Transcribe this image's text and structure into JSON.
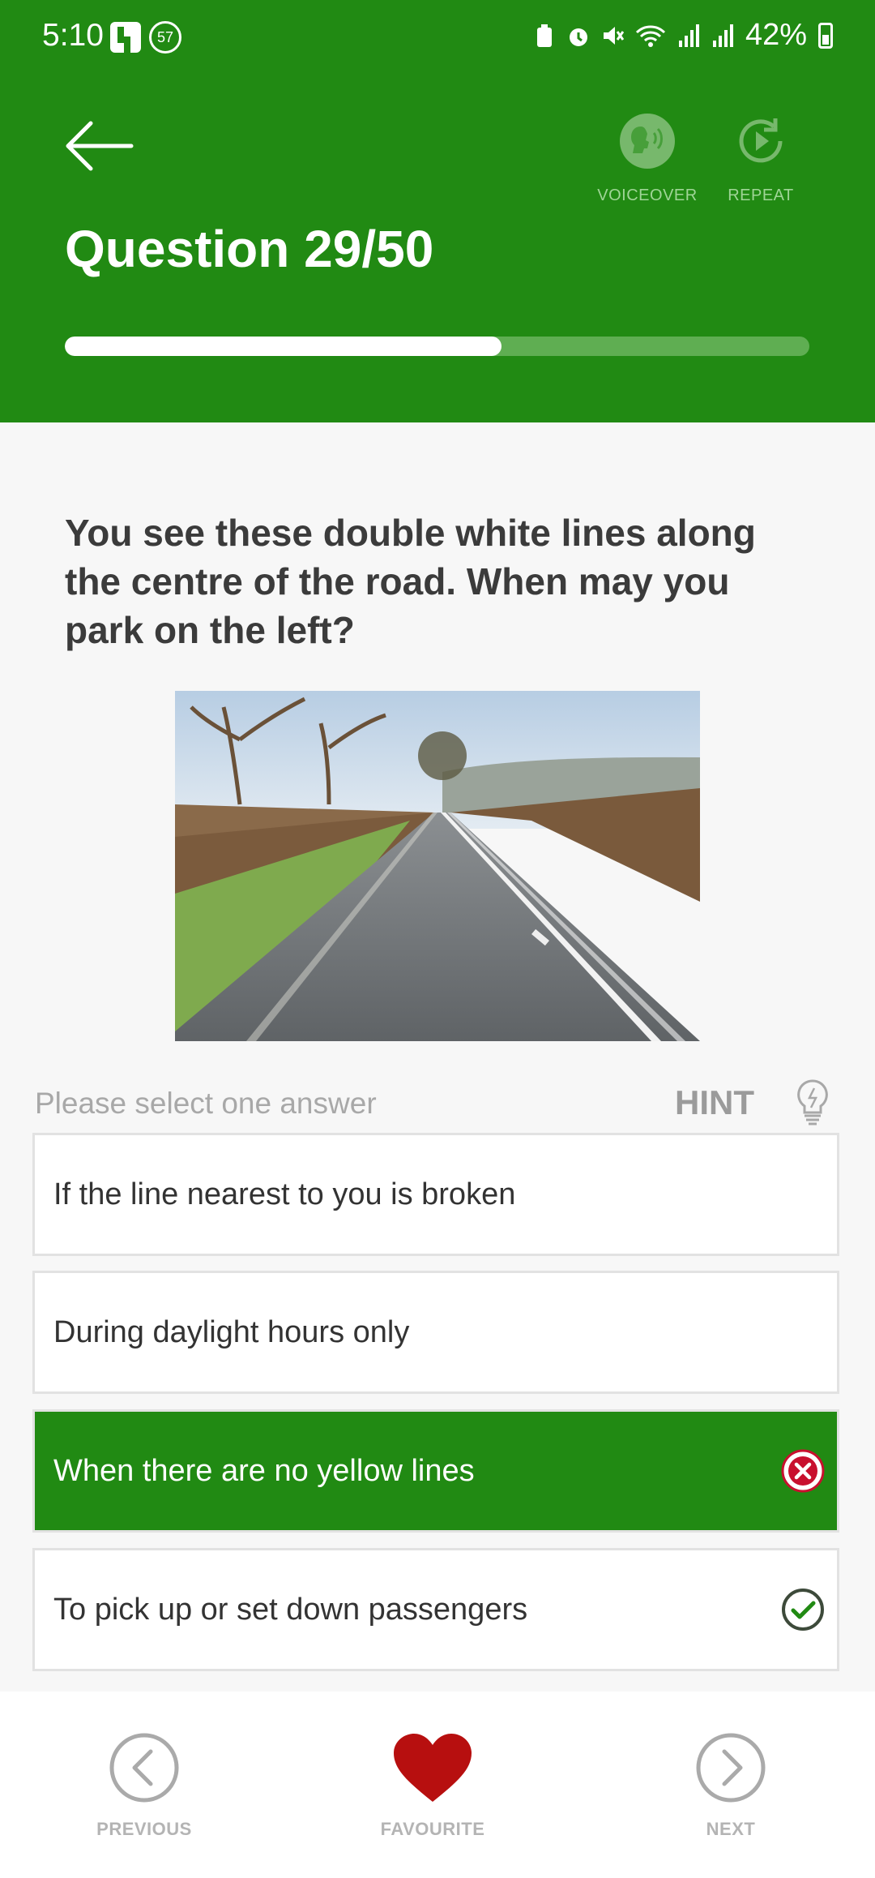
{
  "status_bar": {
    "time": "5:10",
    "notification_badge": "57",
    "battery": "42%",
    "icons": [
      "app-icon",
      "badge-57-icon",
      "battery-saver-icon",
      "alarm-icon",
      "mute-icon",
      "wifi-icon",
      "signal-icon",
      "signal-icon",
      "battery-icon"
    ]
  },
  "header": {
    "title": "Question 29/50",
    "voiceover_label": "VOICEOVER",
    "repeat_label": "REPEAT",
    "progress_fraction": 0.586,
    "background_color": "#218a13"
  },
  "question": {
    "text": "You see these double white lines along the centre of the road. When may you park on the left?",
    "image_semantic": "road-with-double-white-lines-photo"
  },
  "answers_section": {
    "instruction": "Please select one answer",
    "hint_label": "HINT"
  },
  "answers": [
    {
      "label": "If the line nearest to you is broken",
      "state": "none"
    },
    {
      "label": "During daylight hours only",
      "state": "none"
    },
    {
      "label": "When there are no yellow lines",
      "state": "selected-wrong"
    },
    {
      "label": "To pick up or set down passengers",
      "state": "correct"
    }
  ],
  "bottom_nav": {
    "previous_label": "PREVIOUS",
    "favourite_label": "FAVOURITE",
    "next_label": "NEXT",
    "favourite_color": "#b70f0f"
  }
}
